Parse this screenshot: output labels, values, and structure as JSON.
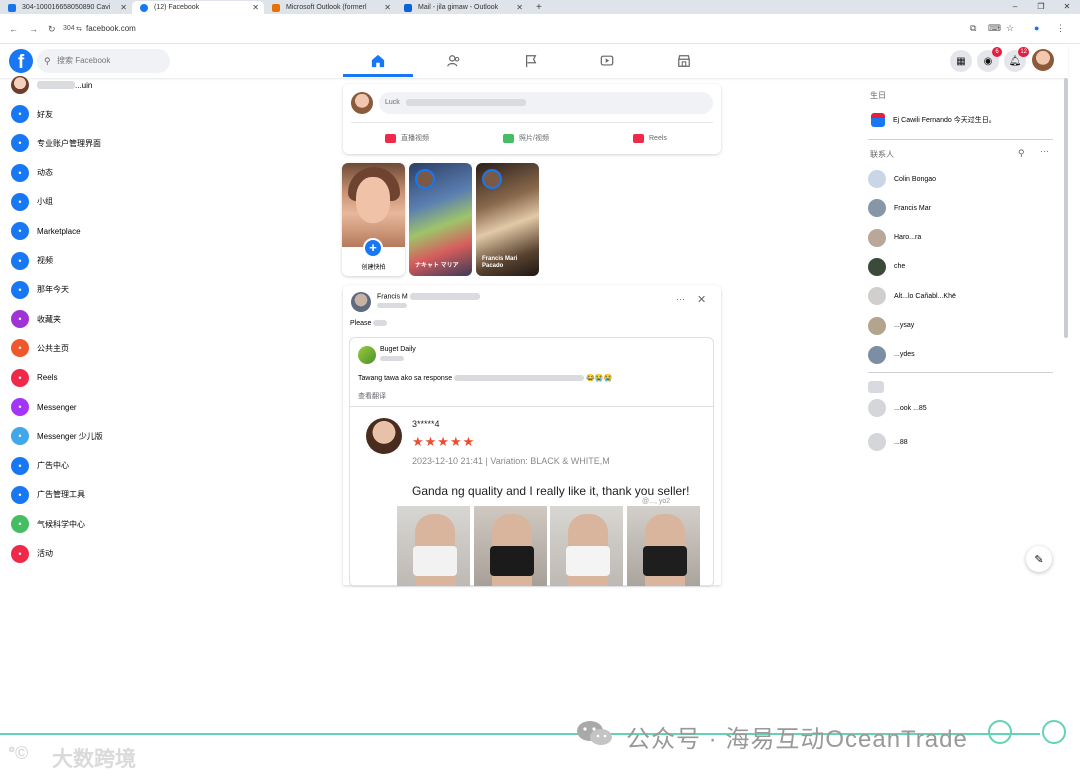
{
  "browser": {
    "tabs": [
      {
        "title": "304-100016658050890 Cavi",
        "color": "#1a73e8",
        "active": false
      },
      {
        "title": "(12) Facebook",
        "color": "#1877f2",
        "active": true
      },
      {
        "title": "Microsoft Outlook (formerl",
        "color": "#e8710a",
        "active": false
      },
      {
        "title": "Mail - jila gimaw - Outlook",
        "color": "#0a64d8",
        "active": false
      }
    ],
    "new_tab": "+",
    "profile_number": "304",
    "url": "facebook.com",
    "window_controls": [
      "–",
      "❐",
      "✕"
    ]
  },
  "header": {
    "logo": "f",
    "search_placeholder": "搜索 Facebook",
    "messenger_badge": "6",
    "notifications_badge": "12"
  },
  "sidebar": {
    "profile_name": "...uin",
    "items": [
      {
        "label": "好友",
        "icon": "friends-icon",
        "color": "#1877f2"
      },
      {
        "label": "专业账户管理界面",
        "icon": "dashboard-icon",
        "color": "#1877f2"
      },
      {
        "label": "动态",
        "icon": "feed-icon",
        "color": "#1877f2"
      },
      {
        "label": "小组",
        "icon": "groups-icon",
        "color": "#1877f2"
      },
      {
        "label": "Marketplace",
        "icon": "marketplace-icon",
        "color": "#1877f2"
      },
      {
        "label": "视频",
        "icon": "video-icon",
        "color": "#1877f2"
      },
      {
        "label": "那年今天",
        "icon": "memories-icon",
        "color": "#1877f2"
      },
      {
        "label": "收藏夹",
        "icon": "saved-icon",
        "color": "#a033d6"
      },
      {
        "label": "公共主页",
        "icon": "pages-icon",
        "color": "#f0582b"
      },
      {
        "label": "Reels",
        "icon": "reels-icon",
        "color": "#f0284a"
      },
      {
        "label": "Messenger",
        "icon": "messenger-icon",
        "color": "#a334fa"
      },
      {
        "label": "Messenger 少儿版",
        "icon": "messenger-kids-icon",
        "color": "#40a8e8"
      },
      {
        "label": "广告中心",
        "icon": "ad-center-icon",
        "color": "#1877f2"
      },
      {
        "label": "广告管理工具",
        "icon": "ads-manager-icon",
        "color": "#1877f2"
      },
      {
        "label": "气候科学中心",
        "icon": "climate-icon",
        "color": "#45bd62"
      },
      {
        "label": "活动",
        "icon": "events-icon",
        "color": "#f02849"
      }
    ]
  },
  "composer": {
    "placeholder": "Luck",
    "actions": [
      {
        "label": "直播视频",
        "color": "#f02849"
      },
      {
        "label": "照片/视频",
        "color": "#45bd62"
      },
      {
        "label": "Reels",
        "color": "#f0284a"
      }
    ]
  },
  "stories": {
    "create_label": "创建快拍",
    "items": [
      {
        "name": "ナキャト マリア"
      },
      {
        "name": "Francis Mari Pacado"
      }
    ]
  },
  "post": {
    "author": "Francis M",
    "text": "Please",
    "shared": {
      "page_name": "Buget Daily",
      "text": "Tawang tawa ako sa response",
      "translate": "查看翻译",
      "review": {
        "user": "3*****4",
        "stars": "★★★★★",
        "meta": "2023-12-10 21:41 | Variation: BLACK & WHITE,M",
        "body": "Ganda ng quality and I really like it, thank you seller!",
        "watermark": "@..., yo2"
      }
    }
  },
  "right_sidebar": {
    "birthdays_heading": "生日",
    "birthday_text": "Ej Cawili Fernando 今天过生日。",
    "contacts_heading": "联系人",
    "contacts": [
      {
        "name": "Colin Bongao"
      },
      {
        "name": "Francis Mar"
      },
      {
        "name": "Haro...ra"
      },
      {
        "name": "che"
      },
      {
        "name": "Alt...lo Cañabl...Khë"
      },
      {
        "name": "...ysay"
      },
      {
        "name": "...ydes"
      }
    ],
    "more_contacts": [
      {
        "name": "...ook ...85"
      },
      {
        "name": "...88"
      }
    ]
  },
  "footer": {
    "wechat_account": "公众号 · 海易互动OceanTrade",
    "brand_logo": "ᐤ©",
    "brand_name": "大数跨境"
  }
}
